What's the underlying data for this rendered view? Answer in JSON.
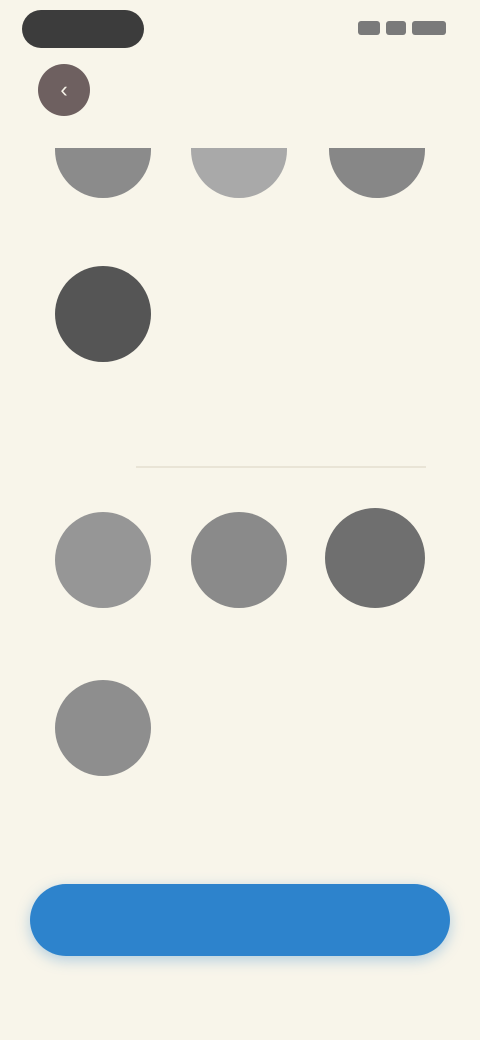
{
  "status_bar": {
    "time": "",
    "icons": [
      "signal-icon",
      "wifi-icon",
      "battery-icon"
    ]
  },
  "header": {
    "title": "",
    "back_icon": "back-arrow-icon"
  },
  "colors": {
    "background": "#f8f5ea",
    "accent": "#2d83cc",
    "section_title": "#5d8fc6"
  },
  "section_one": {
    "items": [
      {
        "label": "",
        "color": "#8b8b8b",
        "shape": "bowl"
      },
      {
        "label": "",
        "color": "#a9a9a9",
        "shape": "bowl"
      },
      {
        "label": "",
        "color": "#878787",
        "shape": "bowl"
      },
      {
        "label": "",
        "color": "#555555",
        "shape": "circle"
      }
    ]
  },
  "section_two": {
    "title": "",
    "items": [
      {
        "label": "",
        "color": "#969696",
        "shape": "circle"
      },
      {
        "label": "",
        "color": "#8a8a8a",
        "shape": "circle"
      },
      {
        "label": "",
        "color": "#6f6f6f",
        "shape": "circle"
      },
      {
        "label": "",
        "color": "#8e8e8e",
        "shape": "circle"
      }
    ]
  },
  "footer": {
    "button_label": ""
  }
}
